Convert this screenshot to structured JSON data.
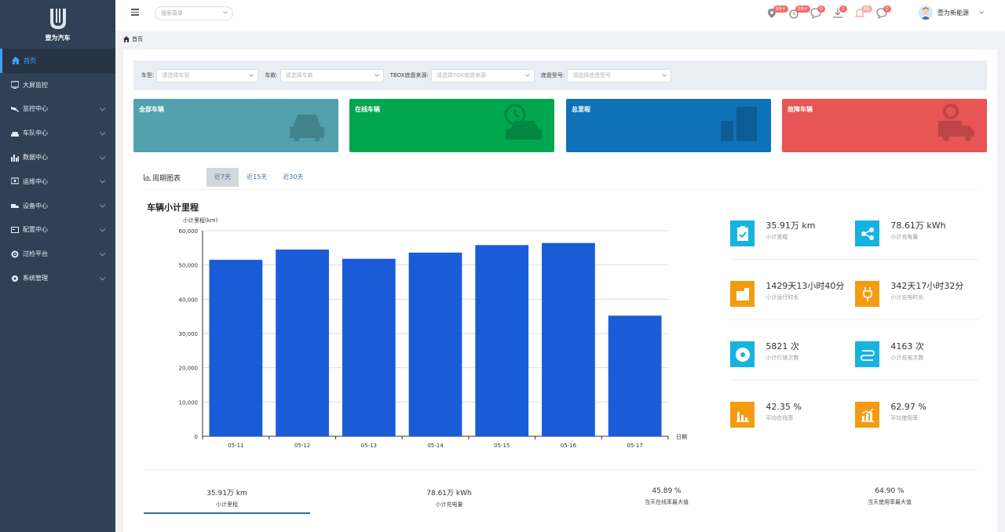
{
  "brand": {
    "name": "壹为汽车"
  },
  "sidebar": {
    "items": [
      {
        "label": "首页",
        "icon": "home-icon",
        "active": true,
        "has_children": false
      },
      {
        "label": "大屏监控",
        "icon": "monitor-icon",
        "active": false,
        "has_children": false
      },
      {
        "label": "监控中心",
        "icon": "camera-icon",
        "active": false,
        "has_children": true
      },
      {
        "label": "车队中心",
        "icon": "car-icon",
        "active": false,
        "has_children": true
      },
      {
        "label": "数据中心",
        "icon": "bar-chart-icon",
        "active": false,
        "has_children": true
      },
      {
        "label": "运维中心",
        "icon": "screen-icon",
        "active": false,
        "has_children": true
      },
      {
        "label": "设备中心",
        "icon": "device-icon",
        "active": false,
        "has_children": true
      },
      {
        "label": "配置中心",
        "icon": "config-icon",
        "active": false,
        "has_children": true
      },
      {
        "label": "过检平台",
        "icon": "gear-icon",
        "active": false,
        "has_children": true
      },
      {
        "label": "系统管理",
        "icon": "settings-icon",
        "active": false,
        "has_children": true
      }
    ]
  },
  "header": {
    "menu_search_placeholder": "搜索菜单",
    "notifications": [
      {
        "icon": "location-icon",
        "badge": "99+"
      },
      {
        "icon": "alarm-clock-icon",
        "badge": "99+"
      },
      {
        "icon": "chat-icon",
        "badge": "0"
      },
      {
        "icon": "download-icon",
        "badge": "1"
      },
      {
        "icon": "bell-icon",
        "badge": "95"
      },
      {
        "icon": "message-icon",
        "badge": "0"
      }
    ],
    "user_name": "壹为新能源"
  },
  "breadcrumb": {
    "home": "首页"
  },
  "filters": [
    {
      "label": "车型:",
      "placeholder": "请选择车型",
      "width": 0
    },
    {
      "label": "车款:",
      "placeholder": "请选择车款"
    },
    {
      "label": "TBOX底盘来源:",
      "placeholder": "请选择TOX底盘来源"
    },
    {
      "label": "底盘型号:",
      "placeholder": "请选择底盘型号"
    }
  ],
  "cards": [
    {
      "title": "全部车辆",
      "color": "#52a1ad",
      "icon": "car-icon"
    },
    {
      "title": "在线车辆",
      "color": "#00a650",
      "icon": "car-clock-icon"
    },
    {
      "title": "总里程",
      "color": "#0e72b8",
      "icon": "mileage-icon"
    },
    {
      "title": "故障车辆",
      "color": "#e85555",
      "icon": "truck-fault-icon"
    }
  ],
  "panel": {
    "title": "周期图表",
    "tabs": [
      {
        "label": "近7天",
        "active": true
      },
      {
        "label": "近15天",
        "active": false
      },
      {
        "label": "近30天",
        "active": false
      }
    ]
  },
  "chart_data": {
    "type": "bar",
    "title": "车辆小计里程",
    "ylabel": "小计里程(km)",
    "xlabel": "日期",
    "categories": [
      "05-11",
      "05-12",
      "05-13",
      "05-14",
      "05-15",
      "05-16",
      "05-17"
    ],
    "values": [
      51500,
      54500,
      51800,
      53600,
      55800,
      56400,
      35200
    ],
    "ylim": [
      0,
      60000
    ],
    "yticks": [
      "0",
      "10,000",
      "20,000",
      "30,000",
      "40,000",
      "50,000",
      "60,000"
    ],
    "bar_color": "#1a5cd7",
    "grid": true
  },
  "stats": [
    {
      "value": "35.91万 km",
      "label": "小计里程",
      "icon": "clipboard-icon",
      "color": "#17b3e0"
    },
    {
      "value": "78.61万 kWh",
      "label": "小计充电量",
      "icon": "share-icon",
      "color": "#17b3e0"
    },
    {
      "value": "1429天13小时40分",
      "label": "小计运行时长",
      "icon": "dashboard-icon",
      "color": "#f39c12"
    },
    {
      "value": "342天17小时32分",
      "label": "小计充电时长",
      "icon": "plug-icon",
      "color": "#f39c12"
    },
    {
      "value": "5821 次",
      "label": "小计行驶次数",
      "icon": "disc-icon",
      "color": "#17b3e0"
    },
    {
      "value": "4163 次",
      "label": "小计充电次数",
      "icon": "route-icon",
      "color": "#17b3e0"
    },
    {
      "value": "42.35 %",
      "label": "平均在线率",
      "icon": "column-chart-icon",
      "color": "#f39c12"
    },
    {
      "value": "62.97 %",
      "label": "平均使用率",
      "icon": "trend-chart-icon",
      "color": "#f39c12"
    }
  ],
  "summary": [
    {
      "value": "35.91万 km",
      "label": "小计里程"
    },
    {
      "value": "78.61万 kWh",
      "label": "小计充电量"
    },
    {
      "value": "45.89 %",
      "label": "当天在线率最大值"
    },
    {
      "value": "64.90 %",
      "label": "当天使用率最大值"
    }
  ]
}
